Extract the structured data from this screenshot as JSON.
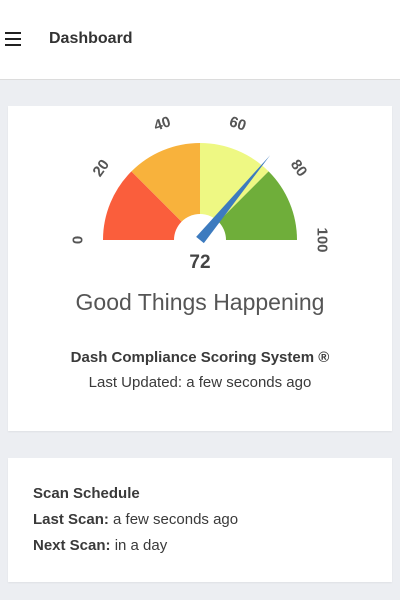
{
  "header": {
    "title": "Dashboard",
    "menu_icon": "hamburger-menu-icon"
  },
  "score_card": {
    "gauge": {
      "value": 72,
      "min": 0,
      "max": 100,
      "tick_labels": [
        "0",
        "20",
        "40",
        "60",
        "80",
        "100"
      ],
      "segments": [
        {
          "from": 0,
          "to": 25,
          "color": "#fa5e3c"
        },
        {
          "from": 25,
          "to": 50,
          "color": "#f8b23c"
        },
        {
          "from": 50,
          "to": 75,
          "color": "#eef883"
        },
        {
          "from": 75,
          "to": 100,
          "color": "#6fae3a"
        }
      ],
      "needle_color": "#3d7bbf"
    },
    "status_text": "Good Things Happening",
    "system_name": "Dash Compliance Scoring System ®",
    "last_updated_label": "Last Updated:",
    "last_updated_value": "a few seconds ago"
  },
  "schedule_card": {
    "title": "Scan Schedule",
    "last_scan_label": "Last Scan:",
    "last_scan_value": "a few seconds ago",
    "next_scan_label": "Next Scan:",
    "next_scan_value": "in a day"
  }
}
